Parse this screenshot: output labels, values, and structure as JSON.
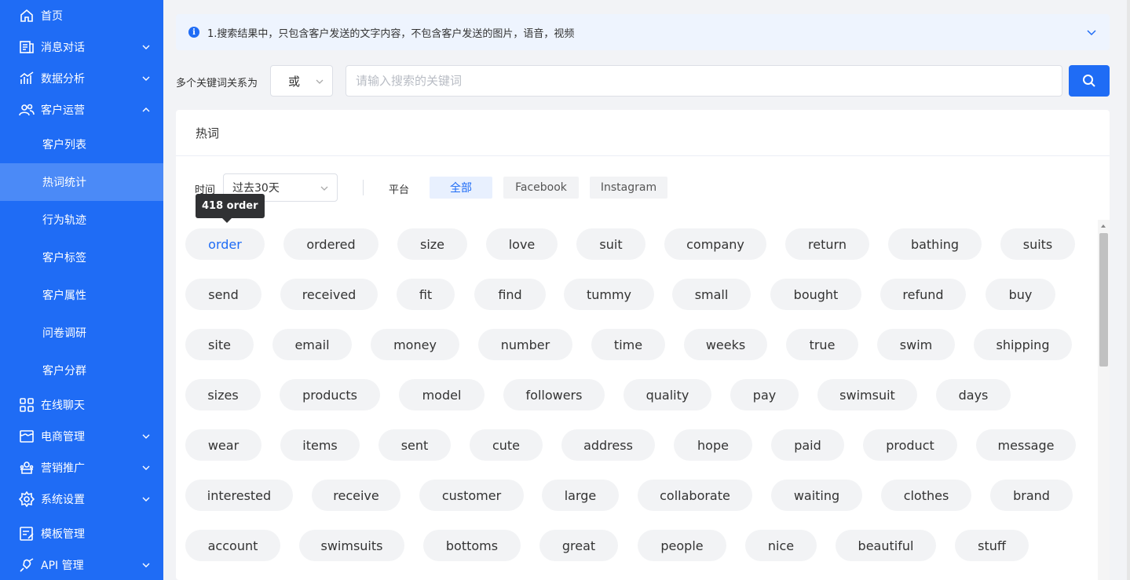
{
  "sidebar": {
    "items": [
      {
        "label": "首页",
        "icon": "home-icon",
        "chevron": ""
      },
      {
        "label": "消息对话",
        "icon": "chat-icon",
        "chevron": "down"
      },
      {
        "label": "数据分析",
        "icon": "chart-icon",
        "chevron": "down"
      },
      {
        "label": "客户运营",
        "icon": "users-icon",
        "chevron": "up"
      }
    ],
    "subitems": [
      {
        "label": "客户列表"
      },
      {
        "label": "热词统计",
        "active": true
      },
      {
        "label": "行为轨迹"
      },
      {
        "label": "客户标签"
      },
      {
        "label": "客户属性"
      },
      {
        "label": "问卷调研"
      },
      {
        "label": "客户分群"
      }
    ],
    "items_after": [
      {
        "label": "在线聊天",
        "icon": "apps-icon",
        "chevron": ""
      },
      {
        "label": "电商管理",
        "icon": "shop-icon",
        "chevron": "down"
      },
      {
        "label": "营销推广",
        "icon": "promo-icon",
        "chevron": "down"
      },
      {
        "label": "系统设置",
        "icon": "gear-icon",
        "chevron": "down"
      },
      {
        "label": "模板管理",
        "icon": "template-icon",
        "chevron": ""
      },
      {
        "label": "API 管理",
        "icon": "api-icon",
        "chevron": "down"
      }
    ]
  },
  "notice": {
    "text": "1.搜索结果中，只包含客户发送的文字内容，不包含客户发送的图片，语音，视频"
  },
  "search": {
    "relation_label": "多个关键词关系为",
    "relation_value": "或",
    "placeholder": "请输入搜索的关键词"
  },
  "card": {
    "title": "热词",
    "time_label": "时间",
    "time_value": "过去30天",
    "platform_label": "平台",
    "platforms": [
      "全部",
      "Facebook",
      "Instagram"
    ],
    "active_platform": "全部",
    "tooltip": "418 order"
  },
  "tags": [
    [
      "order",
      "ordered",
      "size",
      "love",
      "suit",
      "company",
      "return",
      "bathing",
      "suits"
    ],
    [
      "send",
      "received",
      "fit",
      "find",
      "tummy",
      "small",
      "bought",
      "refund",
      "buy"
    ],
    [
      "site",
      "email",
      "money",
      "number",
      "time",
      "weeks",
      "true",
      "swim",
      "shipping"
    ],
    [
      "sizes",
      "products",
      "model",
      "followers",
      "quality",
      "pay",
      "swimsuit",
      "days"
    ],
    [
      "wear",
      "items",
      "sent",
      "cute",
      "address",
      "hope",
      "paid",
      "product",
      "message"
    ],
    [
      "interested",
      "receive",
      "customer",
      "large",
      "collaborate",
      "waiting",
      "clothes",
      "brand"
    ],
    [
      "account",
      "swimsuits",
      "bottoms",
      "great",
      "people",
      "nice",
      "beautiful",
      "stuff"
    ]
  ],
  "colors": {
    "primary": "#1f6cf5",
    "sidebar_active": "#4b8af7",
    "tag_bg": "#f2f3f5"
  }
}
